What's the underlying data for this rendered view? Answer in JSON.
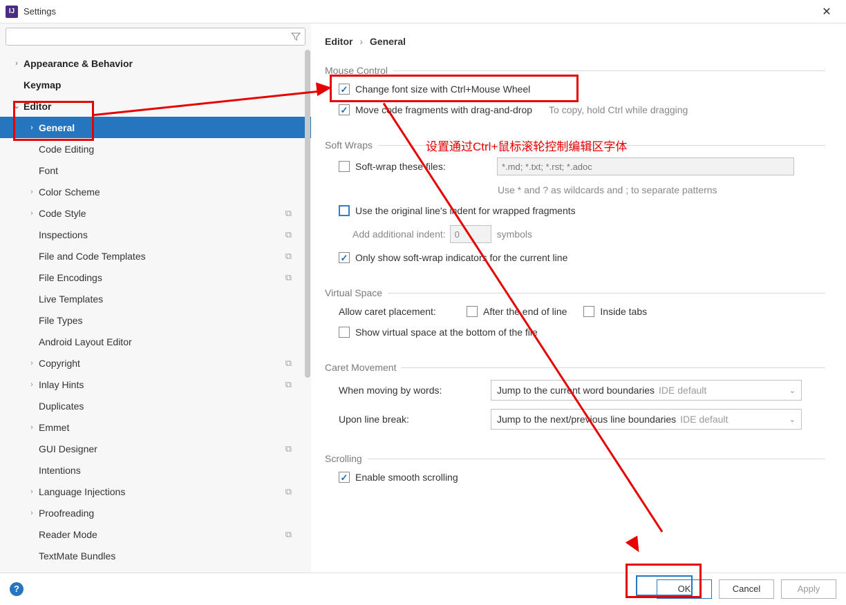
{
  "title": "Settings",
  "search_placeholder": "",
  "breadcrumb": {
    "root": "Editor",
    "sep": "›",
    "leaf": "General"
  },
  "tree": {
    "appearance": "Appearance & Behavior",
    "keymap": "Keymap",
    "editor": "Editor",
    "general": "General",
    "code_editing": "Code Editing",
    "font": "Font",
    "color_scheme": "Color Scheme",
    "code_style": "Code Style",
    "inspections": "Inspections",
    "file_code_templates": "File and Code Templates",
    "file_encodings": "File Encodings",
    "live_templates": "Live Templates",
    "file_types": "File Types",
    "android_layout": "Android Layout Editor",
    "copyright": "Copyright",
    "inlay_hints": "Inlay Hints",
    "duplicates": "Duplicates",
    "emmet": "Emmet",
    "gui_designer": "GUI Designer",
    "intentions": "Intentions",
    "lang_injections": "Language Injections",
    "proofreading": "Proofreading",
    "reader_mode": "Reader Mode",
    "textmate": "TextMate Bundles"
  },
  "sections": {
    "mouse_control": "Mouse Control",
    "soft_wraps": "Soft Wraps",
    "virtual_space": "Virtual Space",
    "caret_movement": "Caret Movement",
    "scrolling": "Scrolling"
  },
  "options": {
    "change_font": "Change font size with Ctrl+Mouse Wheel",
    "move_fragments": "Move code fragments with drag-and-drop",
    "move_hint": "To copy, hold Ctrl while dragging",
    "softwrap_files": "Soft-wrap these files:",
    "softwrap_placeholder": "*.md; *.txt; *.rst; *.adoc",
    "softwrap_hint": "Use * and ? as wildcards and ; to separate patterns",
    "use_original_indent": "Use the original line's indent for wrapped fragments",
    "add_indent_label": "Add additional indent:",
    "add_indent_value": "0",
    "add_indent_suffix": "symbols",
    "only_show_indicators": "Only show soft-wrap indicators for the current line",
    "allow_caret": "Allow caret placement:",
    "after_eol": "After the end of line",
    "inside_tabs": "Inside tabs",
    "show_virtual": "Show virtual space at the bottom of the file",
    "moving_words": "When moving by words:",
    "moving_words_value": "Jump to the current word boundaries",
    "upon_break": "Upon line break:",
    "upon_break_value": "Jump to the next/previous line boundaries",
    "ide_default": "IDE default",
    "smooth_scroll": "Enable smooth scrolling"
  },
  "annotation_text": "设置通过Ctrl+鼠标滚轮控制编辑区字体",
  "buttons": {
    "ok": "OK",
    "cancel": "Cancel",
    "apply": "Apply"
  }
}
